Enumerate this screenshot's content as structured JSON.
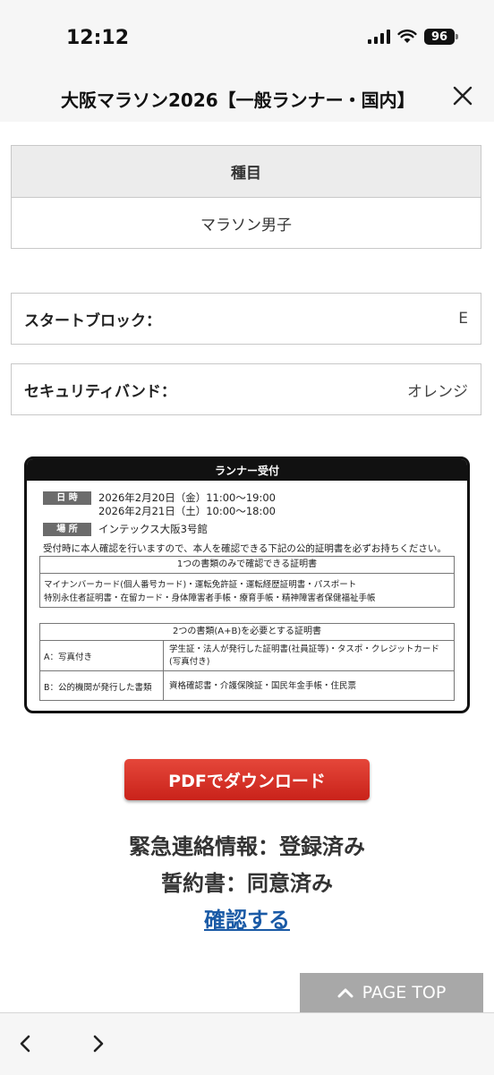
{
  "status_bar": {
    "time": "12:12",
    "battery": "96",
    "icons": [
      "signal-icon",
      "wifi-icon",
      "battery-icon"
    ]
  },
  "header": {
    "title": "大阪マラソン2026【一般ランナー・国内】",
    "close_icon": "close-icon"
  },
  "event": {
    "heading": "種目",
    "value": "マラソン男子"
  },
  "start_block": {
    "label": "スタートブロック：",
    "value": "E"
  },
  "security_band": {
    "label": "セキュリティバンド：",
    "value": "オレンジ"
  },
  "reception": {
    "title": "ランナー受付",
    "datetime_tag": "日 時",
    "datetime_lines": [
      "2026年2月20日（金）11:00〜19:00",
      "2026年2月21日（土）10:00〜18:00"
    ],
    "place_tag": "場 所",
    "place": "インテックス大阪3号館",
    "note": "受付時に本人確認を行いますので、本人を確認できる下記の公的証明書を必ずお持ちください。",
    "single_doc": {
      "heading": "1つの書類のみで確認できる証明書",
      "lines": [
        "マイナンバーカード(個人番号カード)・運転免許証・運転経歴証明書・パスポート",
        "特別永住者証明書・在留カード・身体障害者手帳・療育手帳・精神障害者保健福祉手帳"
      ]
    },
    "double_doc": {
      "heading": "2つの書類(A+B)を必要とする証明書",
      "rows": [
        {
          "label": "A：写真付き",
          "value": "学生証・法人が発行した証明書(社員証等)・タスポ・クレジットカード(写真付き)"
        },
        {
          "label": "B：公的機関が発行した書類",
          "value": "資格確認書・介護保険証・国民年金手帳・住民票"
        }
      ]
    }
  },
  "actions": {
    "pdf_label": "PDFでダウンロード",
    "emergency": "緊急連絡情報：登録済み",
    "pledge": "誓約書：同意済み",
    "confirm_link": "確認する",
    "page_top": "PAGE TOP"
  },
  "colors": {
    "accent_red": "#d9342a",
    "link_blue": "#1a5aa6",
    "page_top_gray": "#a8a8a8"
  }
}
